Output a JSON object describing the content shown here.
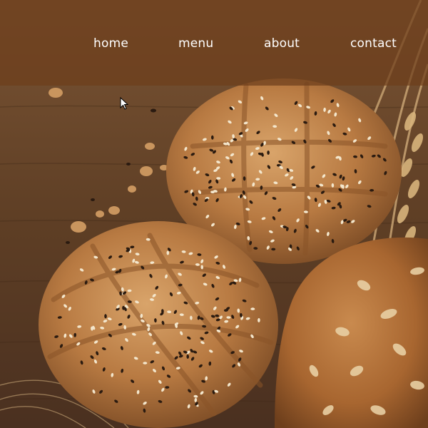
{
  "nav": {
    "items": [
      {
        "label": "home"
      },
      {
        "label": "menu"
      },
      {
        "label": "about"
      },
      {
        "label": "contact"
      }
    ]
  },
  "hero": {
    "image": "bread-rolls-on-wooden-table"
  },
  "colors": {
    "navbar": "#6e3e1c",
    "nav_text": "#ffffff",
    "wood": "#6b4a2e"
  }
}
